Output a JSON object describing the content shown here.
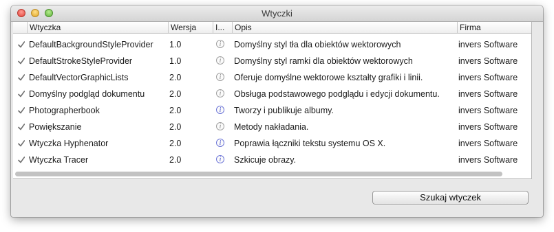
{
  "window": {
    "title": "Wtyczki"
  },
  "table": {
    "columns": [
      "Wtyczka",
      "Wersja",
      "I...",
      "Opis",
      "Firma"
    ],
    "rows": [
      {
        "enabled": true,
        "name": "DefaultBackgroundStyleProvider",
        "version": "1.0",
        "info_icon": "info-icon-gray",
        "description": "Domyślny styl tła dla obiektów wektorowych",
        "company": "invers Software"
      },
      {
        "enabled": true,
        "name": "DefaultStrokeStyleProvider",
        "version": "1.0",
        "info_icon": "info-icon-gray",
        "description": "Domyślny styl ramki dla obiektów wektorowych",
        "company": "invers Software"
      },
      {
        "enabled": true,
        "name": "DefaultVectorGraphicLists",
        "version": "2.0",
        "info_icon": "info-icon-gray",
        "description": "Oferuje domyślne wektorowe kształty grafiki i linii.",
        "company": "invers Software"
      },
      {
        "enabled": true,
        "name": "Domyślny podgląd dokumentu",
        "version": "2.0",
        "info_icon": "info-icon-gray",
        "description": "Obsługa podstawowego podglądu i edycji dokumentu.",
        "company": "invers Software"
      },
      {
        "enabled": true,
        "name": "Photographerbook",
        "version": "2.0",
        "info_icon": "info-icon-blue",
        "description": "Tworzy i publikuje albumy.",
        "company": "invers Software"
      },
      {
        "enabled": true,
        "name": "Powiększanie",
        "version": "2.0",
        "info_icon": "info-icon-gray",
        "description": "Metody nakładania.",
        "company": "invers Software"
      },
      {
        "enabled": true,
        "name": "Wtyczka Hyphenator",
        "version": "2.0",
        "info_icon": "info-icon-blue",
        "description": "Poprawia łączniki tekstu systemu OS X.",
        "company": "invers Software"
      },
      {
        "enabled": true,
        "name": "Wtyczka Tracer",
        "version": "2.0",
        "info_icon": "info-icon-blue",
        "description": "Szkicuje obrazy.",
        "company": "invers Software"
      }
    ]
  },
  "footer": {
    "search_button_label": "Szukaj wtyczek"
  },
  "colors": {
    "info_blue": "#4851c8",
    "info_gray": "#8a8a8a",
    "check": "#6e6e6e"
  }
}
